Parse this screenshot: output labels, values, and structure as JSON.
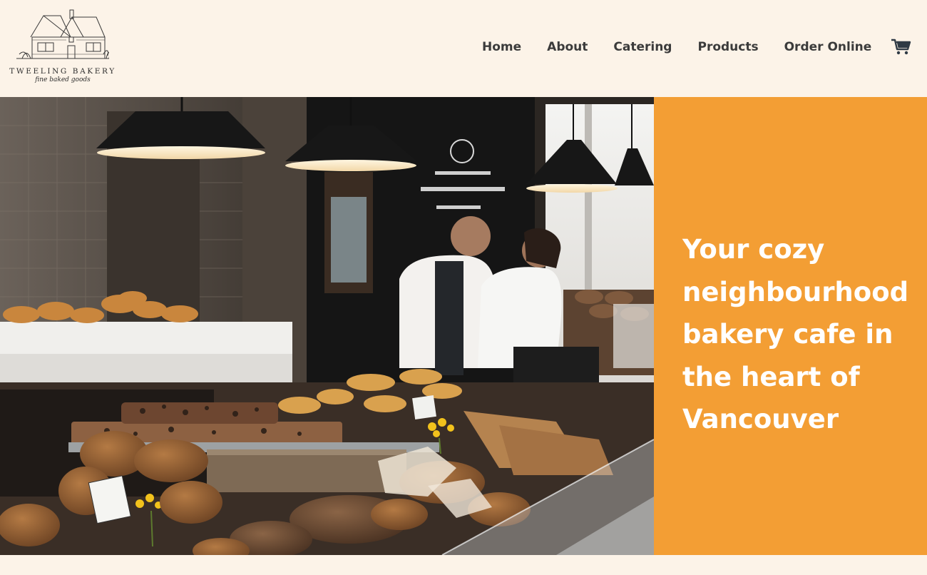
{
  "brand": {
    "name": "TWEELING BAKERY",
    "tagline": "fine baked goods"
  },
  "nav": {
    "items": [
      {
        "label": "Home",
        "name": "nav-home"
      },
      {
        "label": "About",
        "name": "nav-about"
      },
      {
        "label": "Catering",
        "name": "nav-catering"
      },
      {
        "label": "Products",
        "name": "nav-products"
      },
      {
        "label": "Order Online",
        "name": "nav-order-online"
      }
    ],
    "cart_icon": "shopping-cart-icon"
  },
  "hero": {
    "headline": "Your cozy neighbourhood bakery cafe in the heart of Vancouver",
    "image": "bakery-counter-photo"
  },
  "colors": {
    "background": "#fcf3e8",
    "accent": "#f39e34",
    "nav_text": "#3b3b3b",
    "headline_text": "#ffffff"
  }
}
